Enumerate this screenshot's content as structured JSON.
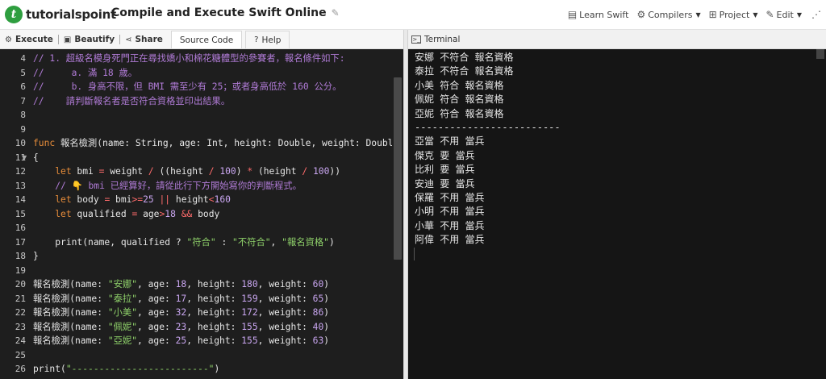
{
  "header": {
    "logo_text": "tutorialspoint",
    "logo_glyph": "t",
    "title": "Compile and Execute Swift Online",
    "nav": [
      {
        "label": "Learn Swift",
        "icon": "book-icon",
        "has_caret": false
      },
      {
        "label": "Compilers",
        "icon": "gear-icon",
        "has_caret": true
      },
      {
        "label": "Project",
        "icon": "grid-icon",
        "has_caret": true
      },
      {
        "label": "Edit",
        "icon": "edit-icon",
        "has_caret": true
      }
    ]
  },
  "toolbar": {
    "execute_label": "Execute",
    "beautify_label": "Beautify",
    "share_label": "Share",
    "source_code_tab": "Source Code",
    "help_tab": "Help"
  },
  "editor": {
    "lines": [
      {
        "n": "4",
        "fold": false,
        "tokens": [
          [
            "c",
            "// 1. 超級名模身死門正在尋找嬌小和棉花糖體型的參賽者，報名條件如下:"
          ]
        ]
      },
      {
        "n": "5",
        "fold": false,
        "tokens": [
          [
            "c",
            "//     a. 滿 18 歲。"
          ]
        ]
      },
      {
        "n": "6",
        "fold": false,
        "tokens": [
          [
            "c",
            "//     b. 身高不限，但 BMI 需至少有 25；或者身高低於 160 公分。"
          ]
        ]
      },
      {
        "n": "7",
        "fold": false,
        "tokens": [
          [
            "c",
            "//    請判斷報名者是否符合資格並印出結果。"
          ]
        ]
      },
      {
        "n": "8",
        "fold": false,
        "tokens": []
      },
      {
        "n": "9",
        "fold": false,
        "tokens": []
      },
      {
        "n": "10",
        "fold": false,
        "tokens": [
          [
            "k",
            "func"
          ],
          [
            "p",
            " 報名檢測(name: String, age: Int, height: Double, weight: Double)"
          ]
        ]
      },
      {
        "n": "11",
        "fold": true,
        "tokens": [
          [
            "p",
            "{"
          ]
        ]
      },
      {
        "n": "12",
        "fold": false,
        "tokens": [
          [
            "p",
            "    "
          ],
          [
            "k",
            "let"
          ],
          [
            "p",
            " bmi "
          ],
          [
            "o",
            "="
          ],
          [
            "p",
            " weight "
          ],
          [
            "o",
            "/"
          ],
          [
            "p",
            " ((height "
          ],
          [
            "o",
            "/"
          ],
          [
            "p",
            " "
          ],
          [
            "n",
            "100"
          ],
          [
            "p",
            ") "
          ],
          [
            "o",
            "*"
          ],
          [
            "p",
            " (height "
          ],
          [
            "o",
            "/"
          ],
          [
            "p",
            " "
          ],
          [
            "n",
            "100"
          ],
          [
            "p",
            "))"
          ]
        ]
      },
      {
        "n": "13",
        "fold": false,
        "tokens": [
          [
            "p",
            "    "
          ],
          [
            "c",
            "// 👇 bmi 已經算好，請從此行下方開始寫你的判斷程式。"
          ]
        ]
      },
      {
        "n": "14",
        "fold": false,
        "tokens": [
          [
            "p",
            "    "
          ],
          [
            "k",
            "let"
          ],
          [
            "p",
            " body "
          ],
          [
            "o",
            "="
          ],
          [
            "p",
            " bmi"
          ],
          [
            "o",
            ">="
          ],
          [
            "n",
            "25"
          ],
          [
            "p",
            " "
          ],
          [
            "o",
            "||"
          ],
          [
            "p",
            " height"
          ],
          [
            "o",
            "<"
          ],
          [
            "n",
            "160"
          ]
        ]
      },
      {
        "n": "15",
        "fold": false,
        "tokens": [
          [
            "p",
            "    "
          ],
          [
            "k",
            "let"
          ],
          [
            "p",
            " qualified "
          ],
          [
            "o",
            "="
          ],
          [
            "p",
            " age"
          ],
          [
            "o",
            ">"
          ],
          [
            "n",
            "18"
          ],
          [
            "p",
            " "
          ],
          [
            "o",
            "&&"
          ],
          [
            "p",
            " body"
          ]
        ]
      },
      {
        "n": "16",
        "fold": false,
        "tokens": []
      },
      {
        "n": "17",
        "fold": false,
        "tokens": [
          [
            "p",
            "    print(name, qualified ? "
          ],
          [
            "s",
            "\"符合\""
          ],
          [
            "p",
            " : "
          ],
          [
            "s",
            "\"不符合\""
          ],
          [
            "p",
            ", "
          ],
          [
            "s",
            "\"報名資格\""
          ],
          [
            "p",
            ")"
          ]
        ]
      },
      {
        "n": "18",
        "fold": false,
        "tokens": [
          [
            "p",
            "}"
          ]
        ]
      },
      {
        "n": "19",
        "fold": false,
        "tokens": []
      },
      {
        "n": "20",
        "fold": false,
        "tokens": [
          [
            "p",
            "報名檢測(name: "
          ],
          [
            "s",
            "\"安娜\""
          ],
          [
            "p",
            ", age: "
          ],
          [
            "n",
            "18"
          ],
          [
            "p",
            ", height: "
          ],
          [
            "n",
            "180"
          ],
          [
            "p",
            ", weight: "
          ],
          [
            "n",
            "60"
          ],
          [
            "p",
            ")"
          ]
        ]
      },
      {
        "n": "21",
        "fold": false,
        "tokens": [
          [
            "p",
            "報名檢測(name: "
          ],
          [
            "s",
            "\"泰拉\""
          ],
          [
            "p",
            ", age: "
          ],
          [
            "n",
            "17"
          ],
          [
            "p",
            ", height: "
          ],
          [
            "n",
            "159"
          ],
          [
            "p",
            ", weight: "
          ],
          [
            "n",
            "65"
          ],
          [
            "p",
            ")"
          ]
        ]
      },
      {
        "n": "22",
        "fold": false,
        "tokens": [
          [
            "p",
            "報名檢測(name: "
          ],
          [
            "s",
            "\"小美\""
          ],
          [
            "p",
            ", age: "
          ],
          [
            "n",
            "32"
          ],
          [
            "p",
            ", height: "
          ],
          [
            "n",
            "172"
          ],
          [
            "p",
            ", weight: "
          ],
          [
            "n",
            "86"
          ],
          [
            "p",
            ")"
          ]
        ]
      },
      {
        "n": "23",
        "fold": false,
        "tokens": [
          [
            "p",
            "報名檢測(name: "
          ],
          [
            "s",
            "\"佩妮\""
          ],
          [
            "p",
            ", age: "
          ],
          [
            "n",
            "23"
          ],
          [
            "p",
            ", height: "
          ],
          [
            "n",
            "155"
          ],
          [
            "p",
            ", weight: "
          ],
          [
            "n",
            "40"
          ],
          [
            "p",
            ")"
          ]
        ]
      },
      {
        "n": "24",
        "fold": false,
        "tokens": [
          [
            "p",
            "報名檢測(name: "
          ],
          [
            "s",
            "\"亞妮\""
          ],
          [
            "p",
            ", age: "
          ],
          [
            "n",
            "25"
          ],
          [
            "p",
            ", height: "
          ],
          [
            "n",
            "155"
          ],
          [
            "p",
            ", weight: "
          ],
          [
            "n",
            "63"
          ],
          [
            "p",
            ")"
          ]
        ]
      },
      {
        "n": "25",
        "fold": false,
        "tokens": []
      },
      {
        "n": "26",
        "fold": false,
        "tokens": [
          [
            "p",
            "print("
          ],
          [
            "s",
            "\"-------------------------\""
          ],
          [
            "p",
            ")"
          ]
        ]
      }
    ]
  },
  "terminal": {
    "title": "Terminal",
    "lines": [
      "安娜 不符合 報名資格",
      "泰拉 不符合 報名資格",
      "小美 符合 報名資格",
      "佩妮 符合 報名資格",
      "亞妮 符合 報名資格",
      "-------------------------",
      "亞當 不用 當兵",
      "傑克 要 當兵",
      "比利 要 當兵",
      "安迪 要 當兵",
      "保羅 不用 當兵",
      "小明 不用 當兵",
      "小華 不用 當兵",
      "阿偉 不用 當兵"
    ]
  },
  "colors": {
    "comment": "#b07bd6",
    "keyword": "#e88d3a",
    "string": "#8fd16a",
    "number": "#c9a6f0",
    "operator": "#ff6b6b",
    "brand": "#2e9e3f"
  }
}
